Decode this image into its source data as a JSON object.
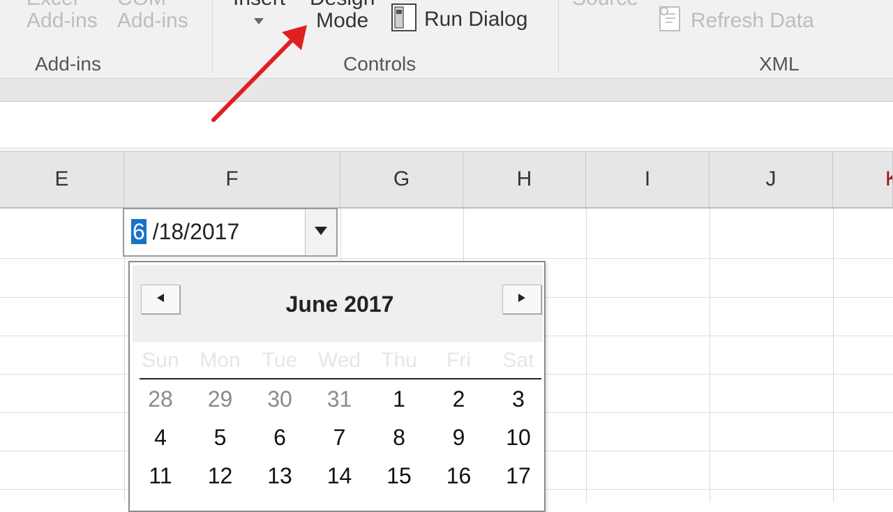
{
  "ribbon": {
    "addins_group": {
      "excel_addins": [
        "Excel",
        "Add-ins"
      ],
      "com_addins": [
        "COM",
        "Add-ins"
      ],
      "label": "Add-ins"
    },
    "controls_group": {
      "insert_label": "Insert",
      "design_mode": [
        "Design",
        "Mode"
      ],
      "run_dialog": "Run Dialog",
      "label": "Controls"
    },
    "xml_group": {
      "source_label": "Source",
      "refresh_data": "Refresh Data",
      "label": "XML"
    }
  },
  "columns": [
    "E",
    "F",
    "G",
    "H",
    "I",
    "J",
    "K"
  ],
  "date_picker": {
    "month_part": "6",
    "rest": " /18/2017"
  },
  "calendar": {
    "title": "June 2017",
    "weekdays": [
      "Sun",
      "Mon",
      "Tue",
      "Wed",
      "Thu",
      "Fri",
      "Sat"
    ],
    "weeks": [
      [
        {
          "d": "28",
          "other": true
        },
        {
          "d": "29",
          "other": true
        },
        {
          "d": "30",
          "other": true
        },
        {
          "d": "31",
          "other": true
        },
        {
          "d": "1"
        },
        {
          "d": "2"
        },
        {
          "d": "3"
        }
      ],
      [
        {
          "d": "4"
        },
        {
          "d": "5"
        },
        {
          "d": "6"
        },
        {
          "d": "7"
        },
        {
          "d": "8"
        },
        {
          "d": "9"
        },
        {
          "d": "10"
        }
      ],
      [
        {
          "d": "11"
        },
        {
          "d": "12"
        },
        {
          "d": "13"
        },
        {
          "d": "14"
        },
        {
          "d": "15"
        },
        {
          "d": "16"
        },
        {
          "d": "17"
        }
      ]
    ]
  },
  "colors": {
    "accent": "#1a73c9",
    "annotation_arrow": "#e02020"
  }
}
